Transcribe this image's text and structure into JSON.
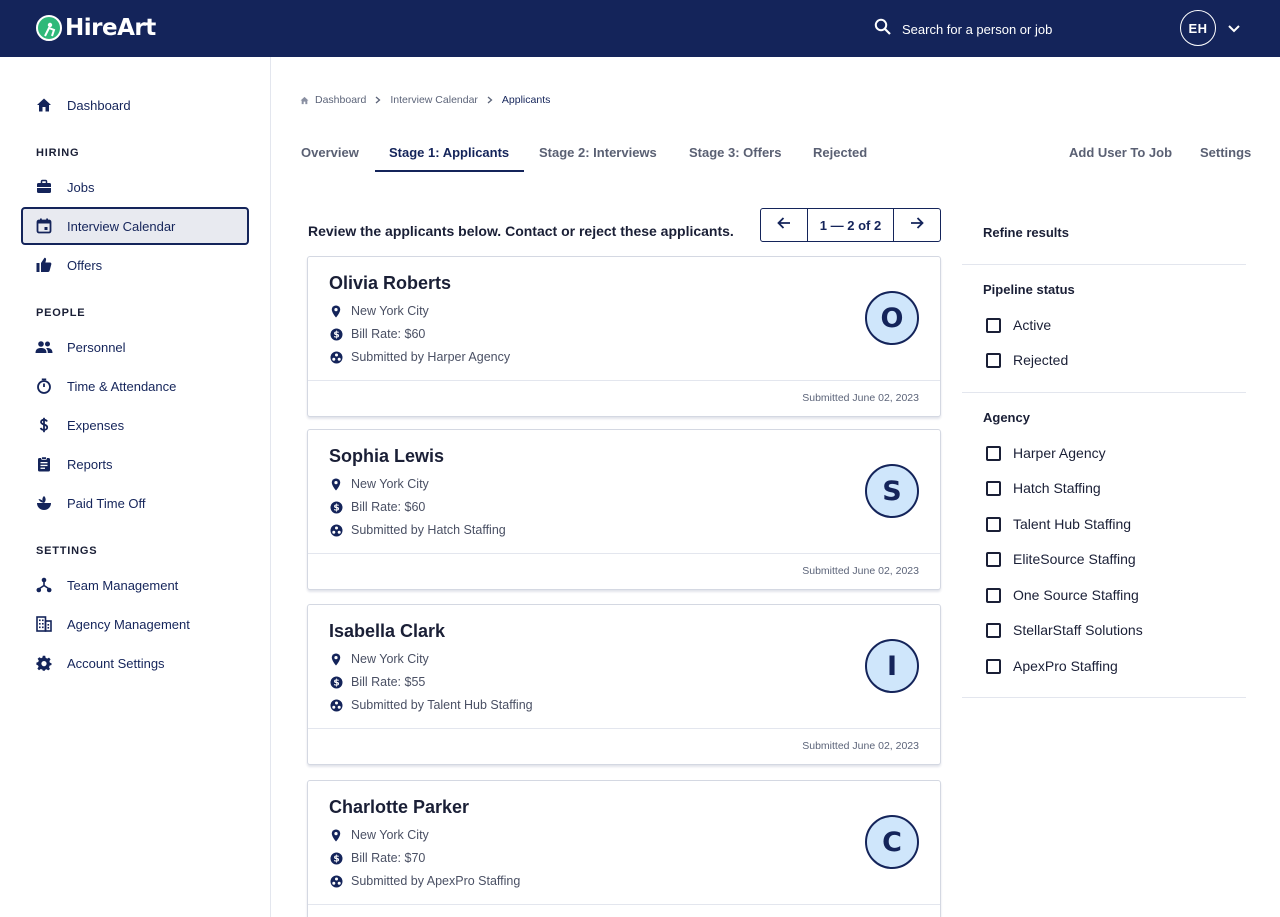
{
  "brand": {
    "name": "HireArt"
  },
  "search": {
    "placeholder": "Search for a person or job"
  },
  "user": {
    "initials": "EH"
  },
  "sidebar": {
    "dashboard": "Dashboard",
    "sections": {
      "hiring": "HIRING",
      "people": "PEOPLE",
      "settings": "SETTINGS"
    },
    "hiring_items": [
      "Jobs",
      "Interview Calendar",
      "Offers"
    ],
    "people_items": [
      "Personnel",
      "Time & Attendance",
      "Expenses",
      "Reports",
      "Paid Time Off"
    ],
    "settings_items": [
      "Team Management",
      "Agency Management",
      "Account Settings"
    ],
    "active_item": "Interview Calendar"
  },
  "breadcrumb": [
    "Dashboard",
    "Interview Calendar",
    "Applicants"
  ],
  "tabs": [
    "Overview",
    "Stage 1: Applicants",
    "Stage 2: Interviews",
    "Stage 3: Offers",
    "Rejected"
  ],
  "active_tab": "Stage 1: Applicants",
  "actions": {
    "add_user": "Add User To Job",
    "settings": "Settings"
  },
  "intro": "Review the applicants below. Contact or reject these applicants.",
  "pagination": {
    "label": "1 — 2 of 2"
  },
  "applicants": [
    {
      "name": "Olivia Roberts",
      "location": "New York City",
      "rate": "Bill Rate: $60",
      "agency": "Submitted by Harper Agency",
      "initial": "O",
      "date": "Submitted June 02, 2023"
    },
    {
      "name": "Sophia Lewis",
      "location": "New York City",
      "rate": "Bill Rate: $60",
      "agency": "Submitted by Hatch Staffing",
      "initial": "S",
      "date": "Submitted June 02, 2023"
    },
    {
      "name": "Isabella Clark",
      "location": "New York City",
      "rate": "Bill Rate: $55",
      "agency": "Submitted by Talent Hub Staffing",
      "initial": "I",
      "date": "Submitted June 02, 2023"
    },
    {
      "name": "Charlotte Parker",
      "location": "New York City",
      "rate": "Bill Rate: $70",
      "agency": "Submitted by ApexPro Staffing",
      "initial": "C",
      "date": ""
    }
  ],
  "filters": {
    "title": "Refine results",
    "pipeline_title": "Pipeline status",
    "pipeline": [
      "Active",
      "Rejected"
    ],
    "agency_title": "Agency",
    "agencies": [
      "Harper Agency",
      "Hatch Staffing",
      "Talent Hub Staffing",
      "EliteSource Staffing",
      "One Source Staffing",
      "StellarStaff Solutions",
      "ApexPro Staffing"
    ]
  },
  "colors": {
    "navy": "#14245a",
    "brand_green": "#2fb979",
    "avatar_bg": "#cfe6fb"
  }
}
